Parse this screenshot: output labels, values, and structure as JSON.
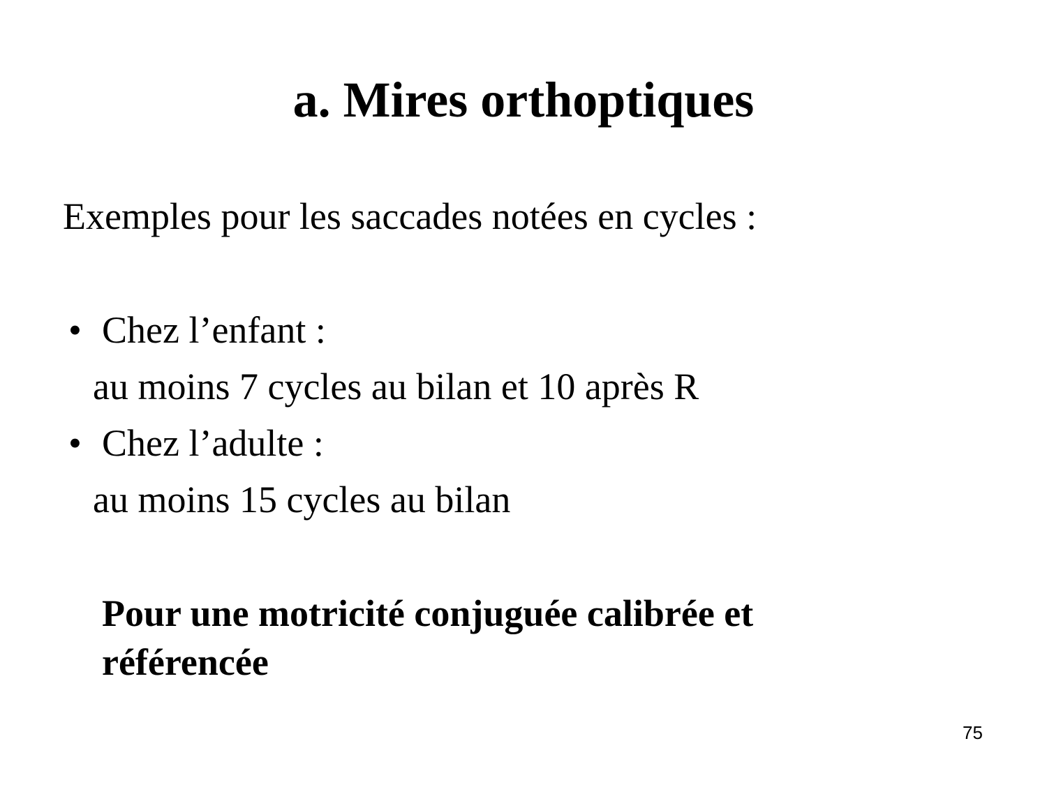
{
  "slide": {
    "title": "a. Mires orthoptiques",
    "intro": "Exemples pour les saccades notées en cycles :",
    "bullets": [
      {
        "marker": "•",
        "label": "Chez l’enfant :",
        "detail": "au moins 7 cycles au bilan et 10 après R"
      },
      {
        "marker": "•",
        "label": "Chez l’adulte :",
        "detail": "au moins 15 cycles au bilan"
      }
    ],
    "conclusion": "Pour une motricité conjuguée calibrée et référencée",
    "page_number": "75"
  }
}
